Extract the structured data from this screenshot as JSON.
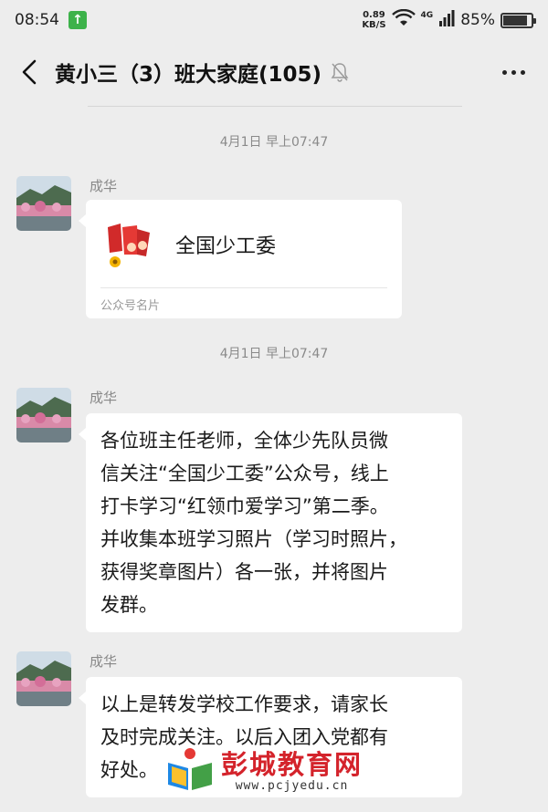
{
  "status_bar": {
    "time": "08:54",
    "net_speed_value": "0.89",
    "net_speed_unit": "KB/S",
    "network_type": "4G",
    "battery_percent": "85%",
    "battery_level": 0.85
  },
  "nav": {
    "title": "黄小三（3）班大家庭(105)"
  },
  "messages": [
    {
      "timestamp": "4月1日 早上07:47",
      "sender": "成华",
      "card": {
        "name": "全国少工委",
        "type_label": "公众号名片"
      }
    },
    {
      "timestamp": "4月1日 早上07:47",
      "sender": "成华",
      "lines": [
        "各位班主任老师，全体少先队员微",
        "信关注“全国少工委”公众号，线上",
        "打卡学习“红领巾爱学习”第二季。",
        "并收集本班学习照片（学习时照片，",
        "获得奖章图片）各一张，并将图片",
        "发群。"
      ]
    },
    {
      "sender": "成华",
      "lines": [
        "以上是转发学校工作要求，请家长",
        "及时完成关注。以后入团入党都有",
        "好处。"
      ]
    }
  ],
  "watermark": {
    "title": "彭城教育网",
    "url": "www.pcjyedu.cn"
  }
}
